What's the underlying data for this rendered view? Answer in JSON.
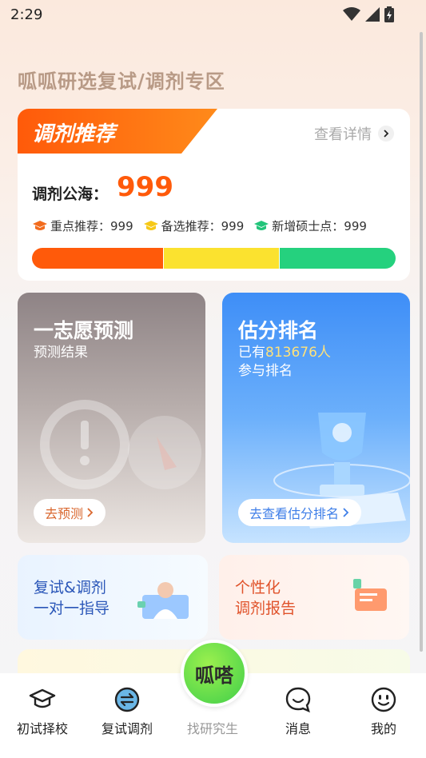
{
  "status": {
    "time": "2:29"
  },
  "page_title": "呱呱研选复试/调剂专区",
  "recommend": {
    "tab_label": "调剂推荐",
    "detail_link": "查看详情",
    "pool_label": "调剂公海：",
    "pool_value": "999",
    "stats": [
      {
        "label": "重点推荐：999",
        "icon": "graduation-cap-icon",
        "color": "#f26b1d"
      },
      {
        "label": "备选推荐：999",
        "icon": "graduation-cap-icon",
        "color": "#f6c817"
      },
      {
        "label": "新增硕士点：999",
        "icon": "graduation-cap-icon",
        "color": "#22c47a"
      }
    ],
    "progress": [
      {
        "fraction": 0.36,
        "color": "#ff5a0a"
      },
      {
        "fraction": 0.32,
        "color": "#fbe22f"
      },
      {
        "fraction": 0.32,
        "color": "#25d17e"
      }
    ]
  },
  "wish_card": {
    "title": "一志愿预测",
    "subtitle": "预测结果",
    "button": "去预测"
  },
  "rank_card": {
    "title": "估分排名",
    "sub_prefix": "已有",
    "sub_count": "813676",
    "sub_suffix": "人",
    "sub_line2": "参与排名",
    "button": "去查看估分排名"
  },
  "guide_card": {
    "line1": "复试&调剂",
    "line2": "一对一指导"
  },
  "report_card": {
    "line1": "个性化",
    "line2": "调剂报告"
  },
  "tabs": {
    "first": "初试择校",
    "retest": "复试调剂",
    "center_badge": "呱嗒",
    "center": "找研究生",
    "messages": "消息",
    "mine": "我的"
  }
}
